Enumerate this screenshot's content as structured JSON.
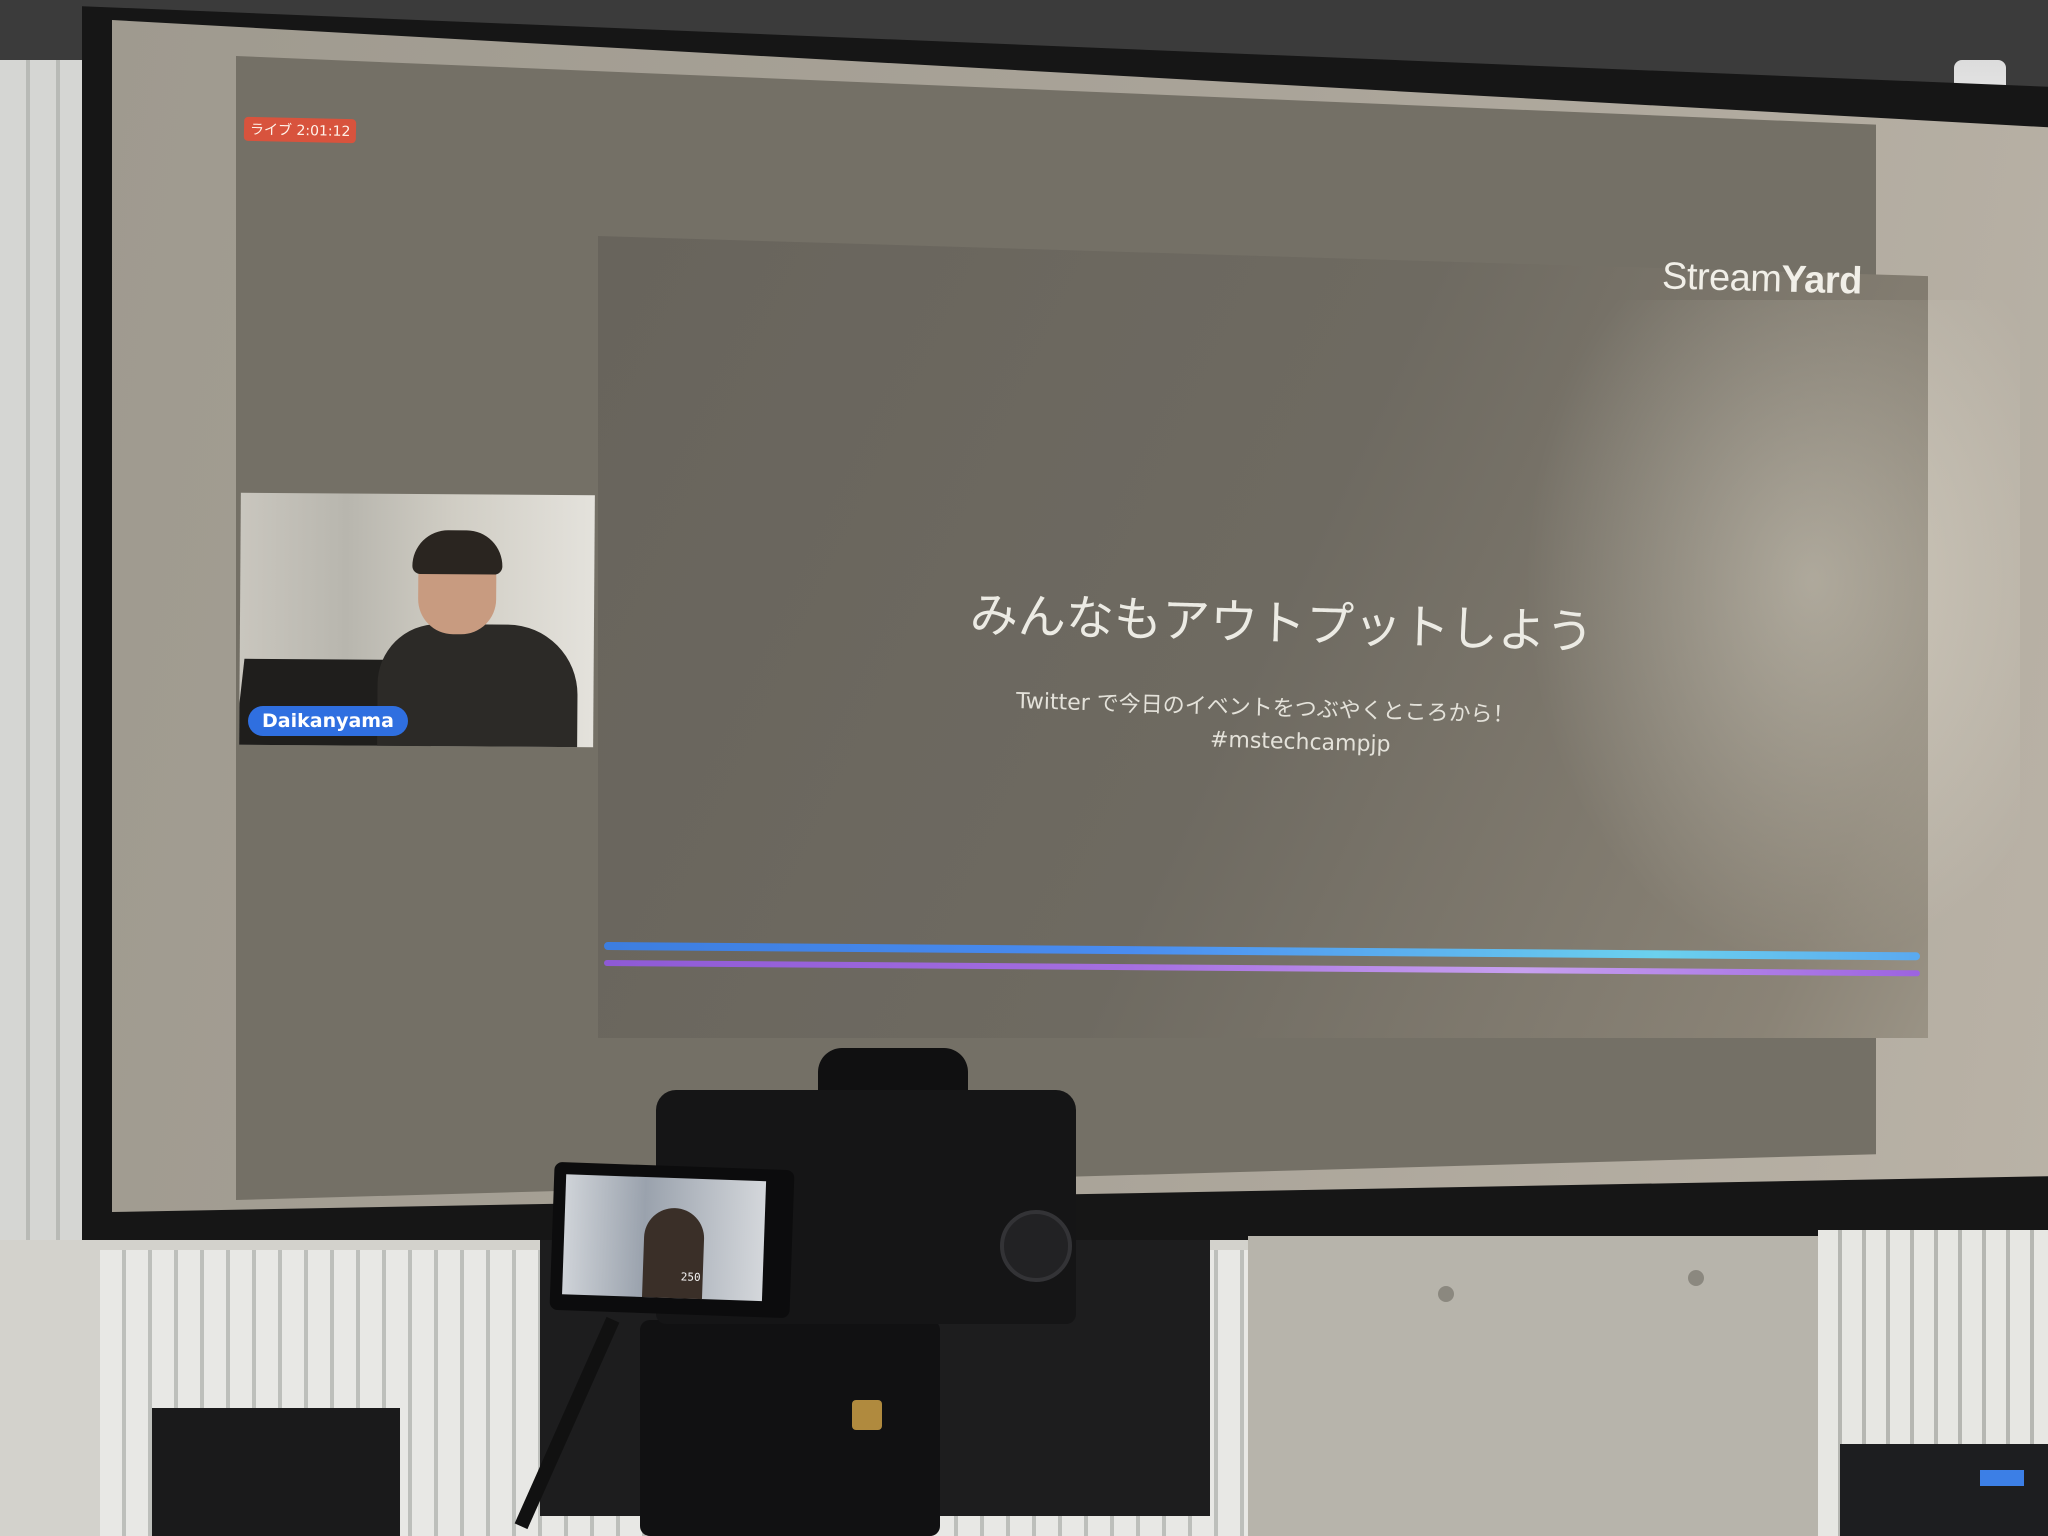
{
  "stream": {
    "live_badge": "ライブ 2:01:12",
    "brand_logo": {
      "light": "Stream",
      "bold": "Yard"
    },
    "speaker_name": "Daikanyama"
  },
  "slide": {
    "title": "みんなもアウトプットしよう",
    "subtitle": "Twitter で今日のイベントをつぶやくところから！",
    "hashtag": "#mstechcampjp"
  },
  "camera": {
    "screen_readout": "250"
  },
  "colors": {
    "live_badge": "#d8533d",
    "name_tag": "#2f6fe0",
    "accent_blue": "#4a8cf0",
    "accent_purple": "#a56fe0"
  }
}
